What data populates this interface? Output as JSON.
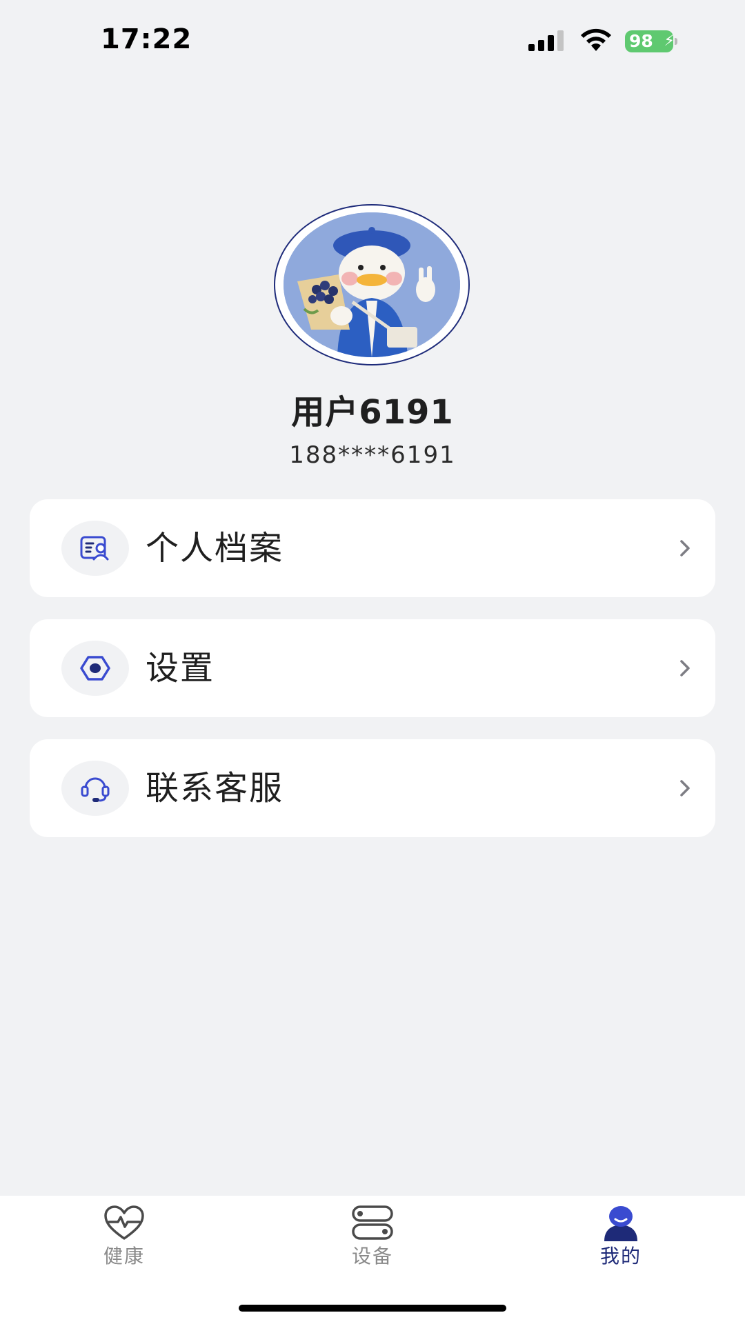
{
  "status_bar": {
    "time": "17:22",
    "battery_level": "98",
    "battery_charging": true,
    "signal_bars": 3,
    "icons": [
      "signal-icon",
      "wifi-icon",
      "battery-icon"
    ]
  },
  "profile": {
    "avatar": "duck-avatar-image",
    "name": "用户6191",
    "phone": "188****6191"
  },
  "menu": {
    "items": [
      {
        "label": "个人档案",
        "icon": "profile-card-icon"
      },
      {
        "label": "设置",
        "icon": "settings-hex-icon"
      },
      {
        "label": "联系客服",
        "icon": "headset-icon"
      }
    ],
    "chevron_icon": "chevron-right-icon"
  },
  "tab_bar": {
    "tabs": [
      {
        "label": "健康",
        "icon": "heart-pulse-icon",
        "active": false
      },
      {
        "label": "设备",
        "icon": "device-icon",
        "active": false
      },
      {
        "label": "我的",
        "icon": "person-icon",
        "active": true
      }
    ]
  },
  "colors": {
    "background": "#f1f2f4",
    "accent": "#1e2a78",
    "icon_accent": "#3a4bd0",
    "inactive": "#8a8a8a",
    "battery": "#5fc970"
  }
}
